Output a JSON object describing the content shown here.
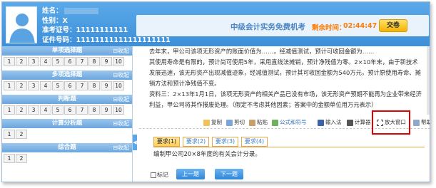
{
  "candidate": {
    "name_label": "姓名：",
    "gender_label": "性别：X",
    "admission_label": "准考证号：11111111111",
    "id_label": "证件号码：11111111111111111111"
  },
  "exam": {
    "title": "中级会计实务免费机考",
    "time_label": "剩余时间：",
    "time_value": "02:44:47",
    "submit_label": "交卷"
  },
  "sections": [
    {
      "title": "单项选择题",
      "collapse": "收起",
      "rows": [
        [
          "1",
          "2",
          "3",
          "4",
          "5",
          "6",
          "7",
          "8",
          "9",
          "10"
        ]
      ]
    },
    {
      "title": "多项选择题",
      "collapse": "收起",
      "rows": [
        [
          "1",
          "2",
          "3",
          "4",
          "5",
          "6",
          "7",
          "8",
          "9",
          "10"
        ]
      ]
    },
    {
      "title": "判断题",
      "collapse": "收起",
      "rows": [
        [
          "1",
          "2",
          "3",
          "4",
          "5",
          "6",
          "7",
          "8",
          "9",
          "10"
        ]
      ]
    },
    {
      "title": "计算分析题",
      "collapse": "收起",
      "rows": [
        [
          "1",
          "2"
        ]
      ]
    },
    {
      "title": "综合题",
      "collapse": "收起",
      "rows": [
        [
          "1",
          "2"
        ]
      ]
    }
  ],
  "passage": [
    "去年末，甲公司该项无形资产的账面价值为……，经减值测试，预计可收回金额为……",
    "其使用寿命是有限的，预计尚可使用5年，采用直线法摊销，预计净残值为零。2×10年末，由于新技术",
    "发展迅速，该无形资产出现减值迹象，经减值测试，预计其可收回金额为540万元，预计原使用寿命、摊",
    "销方法和预计净残值不变。",
    "资料三：2×13年1月1日，该项无形资产的相关产品已没有市场，该无形资产预期不能再为企业带来经济",
    "利益，甲公司将其作报废处理。（假定不考虑其他因素；答案中的金额单位用万元表示）"
  ],
  "toolbar": {
    "copy": "复制",
    "cut": "剪切",
    "paste": "粘贴",
    "formula": "公式和符号",
    "input_method": "输入法",
    "calculator": "计算器",
    "enlarge": "放大窗口",
    "help": "帮助"
  },
  "tabs": [
    "要求(1)",
    "要求(2)",
    "要求(3)",
    "要求(4)"
  ],
  "question": "编制甲公司20×8年度的有关会计分录。",
  "mark_label": "标记",
  "prev_label": "上一题",
  "next_label": "下一题",
  "colors": {
    "header": "#3d8fd8",
    "accent": "#ff7a00",
    "highlight": "#e30000"
  }
}
